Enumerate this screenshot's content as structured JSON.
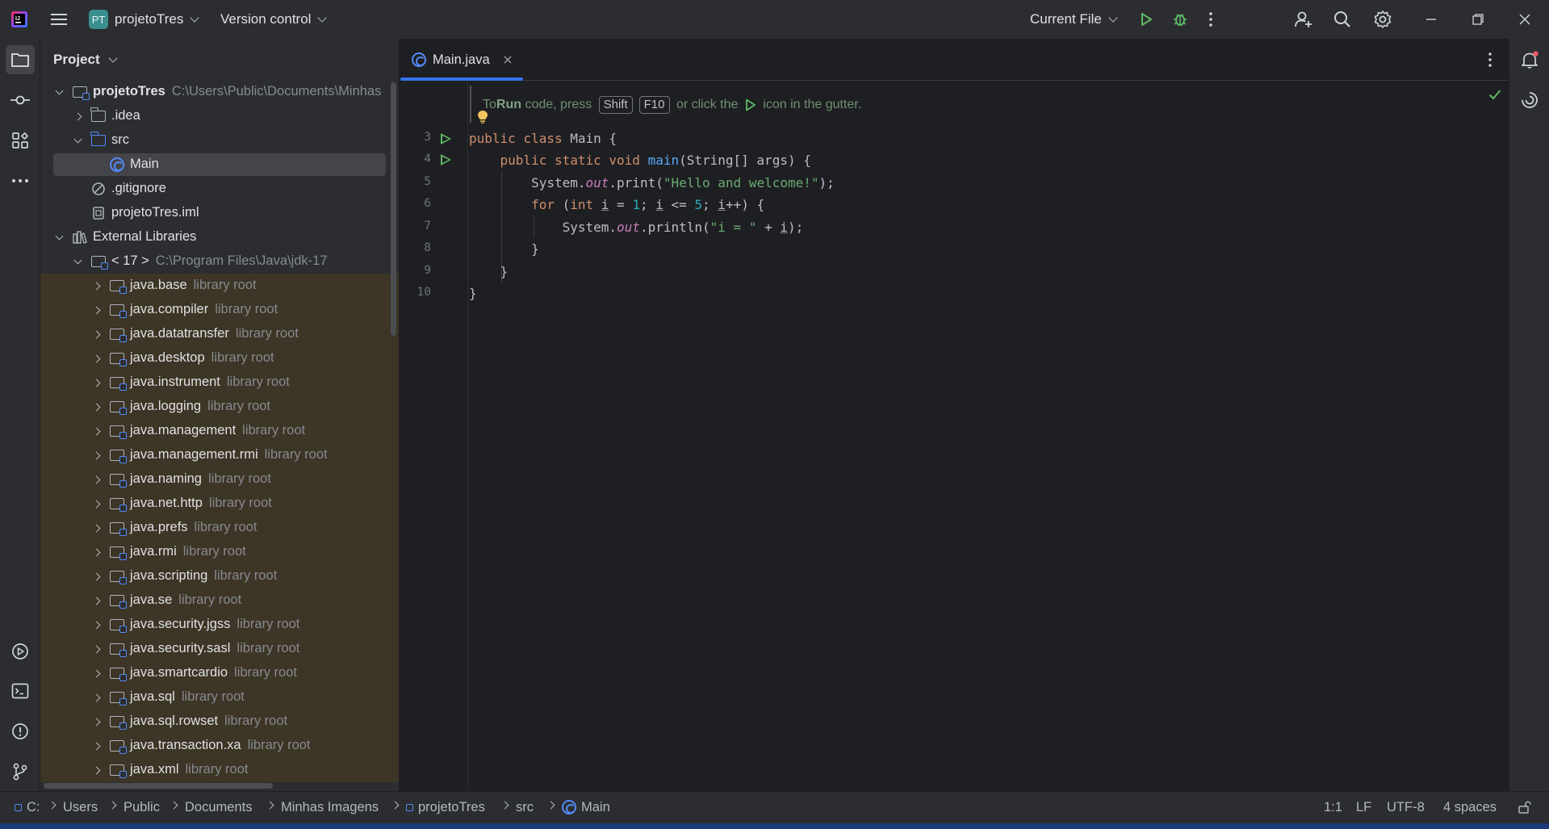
{
  "titlebar": {
    "project_badge": "PT",
    "project_name": "projetoTres",
    "vcs": "Version control",
    "run_config": "Current File"
  },
  "project_panel": {
    "title": "Project",
    "tree": [
      {
        "label": "projetoTres",
        "sub": "C:\\Users\\Public\\Documents\\Minhas",
        "depth": 0,
        "arrow": "down",
        "icon": "module",
        "bold": true
      },
      {
        "label": ".idea",
        "sub": "",
        "depth": 1,
        "arrow": "right",
        "icon": "folder"
      },
      {
        "label": "src",
        "sub": "",
        "depth": 1,
        "arrow": "down",
        "icon": "folder-blue"
      },
      {
        "label": "Main",
        "sub": "",
        "depth": 2,
        "arrow": "none",
        "icon": "class",
        "selected": true
      },
      {
        "label": ".gitignore",
        "sub": "",
        "depth": 1,
        "arrow": "none",
        "icon": "ignore"
      },
      {
        "label": "projetoTres.iml",
        "sub": "",
        "depth": 1,
        "arrow": "none",
        "icon": "file"
      },
      {
        "label": "External Libraries",
        "sub": "",
        "depth": 0,
        "arrow": "down",
        "icon": "libraries"
      },
      {
        "label": "< 17 >",
        "sub": "C:\\Program Files\\Java\\jdk-17",
        "depth": 1,
        "arrow": "down",
        "icon": "jdk"
      },
      {
        "label": "java.base",
        "sub": "library root",
        "depth": 2,
        "arrow": "right",
        "icon": "lib",
        "lib": true
      },
      {
        "label": "java.compiler",
        "sub": "library root",
        "depth": 2,
        "arrow": "right",
        "icon": "lib",
        "lib": true
      },
      {
        "label": "java.datatransfer",
        "sub": "library root",
        "depth": 2,
        "arrow": "right",
        "icon": "lib",
        "lib": true
      },
      {
        "label": "java.desktop",
        "sub": "library root",
        "depth": 2,
        "arrow": "right",
        "icon": "lib",
        "lib": true
      },
      {
        "label": "java.instrument",
        "sub": "library root",
        "depth": 2,
        "arrow": "right",
        "icon": "lib",
        "lib": true
      },
      {
        "label": "java.logging",
        "sub": "library root",
        "depth": 2,
        "arrow": "right",
        "icon": "lib",
        "lib": true
      },
      {
        "label": "java.management",
        "sub": "library root",
        "depth": 2,
        "arrow": "right",
        "icon": "lib",
        "lib": true
      },
      {
        "label": "java.management.rmi",
        "sub": "library root",
        "depth": 2,
        "arrow": "right",
        "icon": "lib",
        "lib": true
      },
      {
        "label": "java.naming",
        "sub": "library root",
        "depth": 2,
        "arrow": "right",
        "icon": "lib",
        "lib": true
      },
      {
        "label": "java.net.http",
        "sub": "library root",
        "depth": 2,
        "arrow": "right",
        "icon": "lib",
        "lib": true
      },
      {
        "label": "java.prefs",
        "sub": "library root",
        "depth": 2,
        "arrow": "right",
        "icon": "lib",
        "lib": true
      },
      {
        "label": "java.rmi",
        "sub": "library root",
        "depth": 2,
        "arrow": "right",
        "icon": "lib",
        "lib": true
      },
      {
        "label": "java.scripting",
        "sub": "library root",
        "depth": 2,
        "arrow": "right",
        "icon": "lib",
        "lib": true
      },
      {
        "label": "java.se",
        "sub": "library root",
        "depth": 2,
        "arrow": "right",
        "icon": "lib",
        "lib": true
      },
      {
        "label": "java.security.jgss",
        "sub": "library root",
        "depth": 2,
        "arrow": "right",
        "icon": "lib",
        "lib": true
      },
      {
        "label": "java.security.sasl",
        "sub": "library root",
        "depth": 2,
        "arrow": "right",
        "icon": "lib",
        "lib": true
      },
      {
        "label": "java.smartcardio",
        "sub": "library root",
        "depth": 2,
        "arrow": "right",
        "icon": "lib",
        "lib": true
      },
      {
        "label": "java.sql",
        "sub": "library root",
        "depth": 2,
        "arrow": "right",
        "icon": "lib",
        "lib": true
      },
      {
        "label": "java.sql.rowset",
        "sub": "library root",
        "depth": 2,
        "arrow": "right",
        "icon": "lib",
        "lib": true
      },
      {
        "label": "java.transaction.xa",
        "sub": "library root",
        "depth": 2,
        "arrow": "right",
        "icon": "lib",
        "lib": true
      },
      {
        "label": "java.xml",
        "sub": "library root",
        "depth": 2,
        "arrow": "right",
        "icon": "lib",
        "lib": true
      }
    ]
  },
  "editor": {
    "tab_label": "Main.java",
    "hint": {
      "part1": "To ",
      "run_word": "Run",
      "part2": " code, press ",
      "key1": "Shift",
      "key2": "F10",
      "part3": " or click the ",
      "part4": " icon in the gutter."
    },
    "line_numbers": [
      "3",
      "4",
      "5",
      "6",
      "7",
      "8",
      "9",
      "10"
    ],
    "code": {
      "l3_kw": "public class ",
      "l3_rest": "Main {",
      "l4_kw": "public static void ",
      "l4_fn": "main",
      "l4_rest": "(String[] args) {",
      "l5_a": "System.",
      "l5_fld": "out",
      "l5_b": ".print(",
      "l5_str": "\"Hello and welcome!\"",
      "l5_c": ");",
      "l6_kw": "for ",
      "l6_a": "(",
      "l6_kw2": "int ",
      "l6_v1": "i",
      "l6_b": " = ",
      "l6_n1": "1",
      "l6_c": "; ",
      "l6_v2": "i",
      "l6_d": " <= ",
      "l6_n2": "5",
      "l6_e": "; ",
      "l6_v3": "i",
      "l6_f": "++) {",
      "l7_a": "System.",
      "l7_fld": "out",
      "l7_b": ".println(",
      "l7_str": "\"i = \"",
      "l7_c": " + ",
      "l7_v": "i",
      "l7_d": ");",
      "l8": "}",
      "l9": "}",
      "l10": "}"
    }
  },
  "statusbar": {
    "crumbs": [
      "C:",
      "Users",
      "Public",
      "Documents",
      "Minhas Imagens",
      "projetoTres",
      "src",
      "Main"
    ],
    "position": "1:1",
    "line_sep": "LF",
    "encoding": "UTF-8",
    "indent": "4 spaces"
  },
  "colors": {
    "accent": "#3574f0",
    "run_green": "#5fb865",
    "library_bg": "#3d3525"
  }
}
